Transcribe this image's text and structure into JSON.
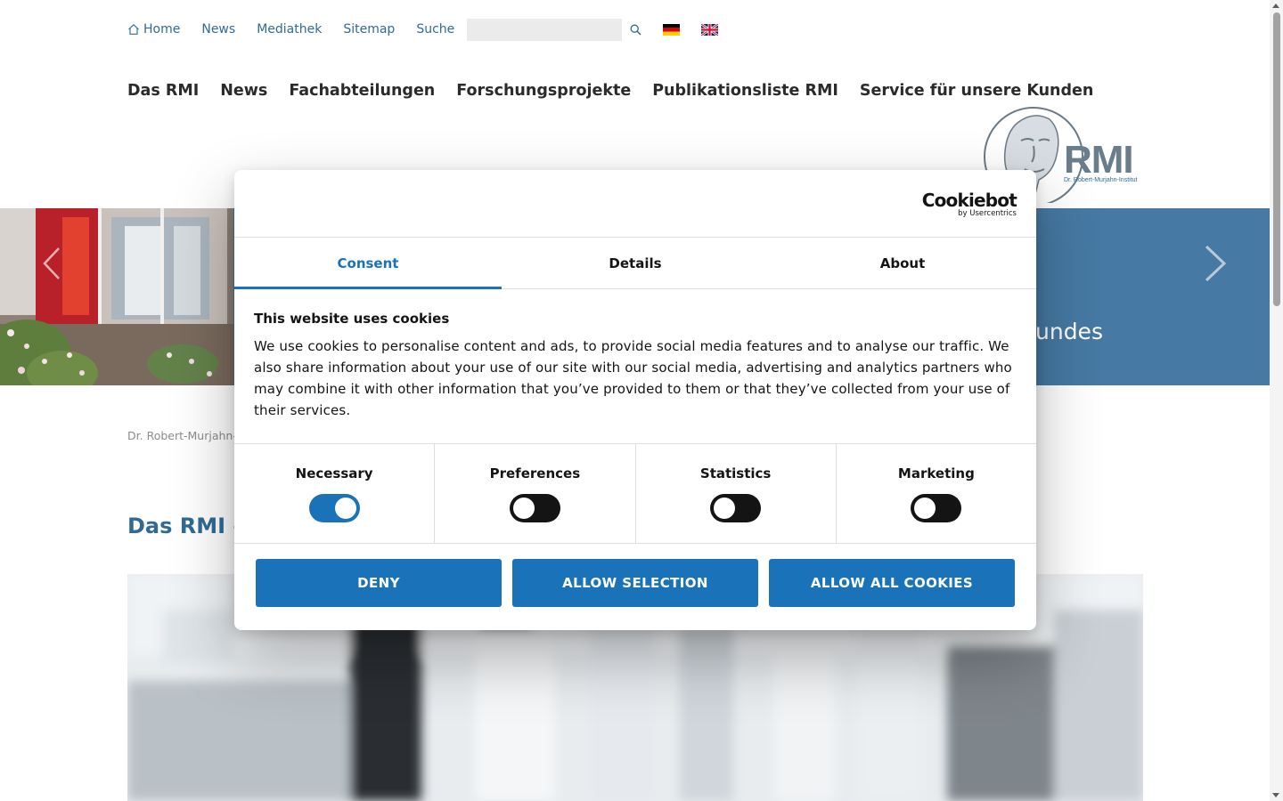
{
  "utility_nav": {
    "home": "Home",
    "news": "News",
    "mediathek": "Mediathek",
    "sitemap": "Sitemap",
    "suche": "Suche",
    "search_value": "",
    "search_placeholder": ""
  },
  "main_nav": [
    "Das RMI",
    "News",
    "Fachabteilungen",
    "Forschungsprojekte",
    "Publikationsliste RMI",
    "Service für unsere Kunden"
  ],
  "logo": {
    "mark": "RMI",
    "tagline": "Dr. Robert-Murjahn-Institut"
  },
  "hero": {
    "visible_text": "undes",
    "background_color": "#4679a3"
  },
  "breadcrumb": "Dr. Robert-Murjahn-",
  "page_title": "Das RMI –",
  "cookie_dialog": {
    "brand": "Cookiebot",
    "brand_sub": "by Usercentrics",
    "tabs": [
      {
        "label": "Consent",
        "active": true
      },
      {
        "label": "Details",
        "active": false
      },
      {
        "label": "About",
        "active": false
      }
    ],
    "heading": "This website uses cookies",
    "body": "We use cookies to personalise content and ads, to provide social media features and to analyse our traffic. We also share information about your use of our site with our social media, advertising and analytics partners who may combine it with other information that you’ve provided to them or that they’ve collected from your use of their services.",
    "categories": [
      {
        "label": "Necessary",
        "enabled": true
      },
      {
        "label": "Preferences",
        "enabled": false
      },
      {
        "label": "Statistics",
        "enabled": false
      },
      {
        "label": "Marketing",
        "enabled": false
      }
    ],
    "buttons": {
      "deny": "DENY",
      "allow_selection": "ALLOW SELECTION",
      "allow_all": "ALLOW ALL COOKIES"
    },
    "accent_color": "#1a73b8"
  },
  "colors": {
    "link": "#2f6b95",
    "hero": "#4679a3",
    "accent": "#1a73b8"
  },
  "icons": [
    "home-icon",
    "search-icon",
    "flag-de-icon",
    "flag-uk-icon",
    "chevron-right-icon",
    "chevron-left-icon"
  ]
}
